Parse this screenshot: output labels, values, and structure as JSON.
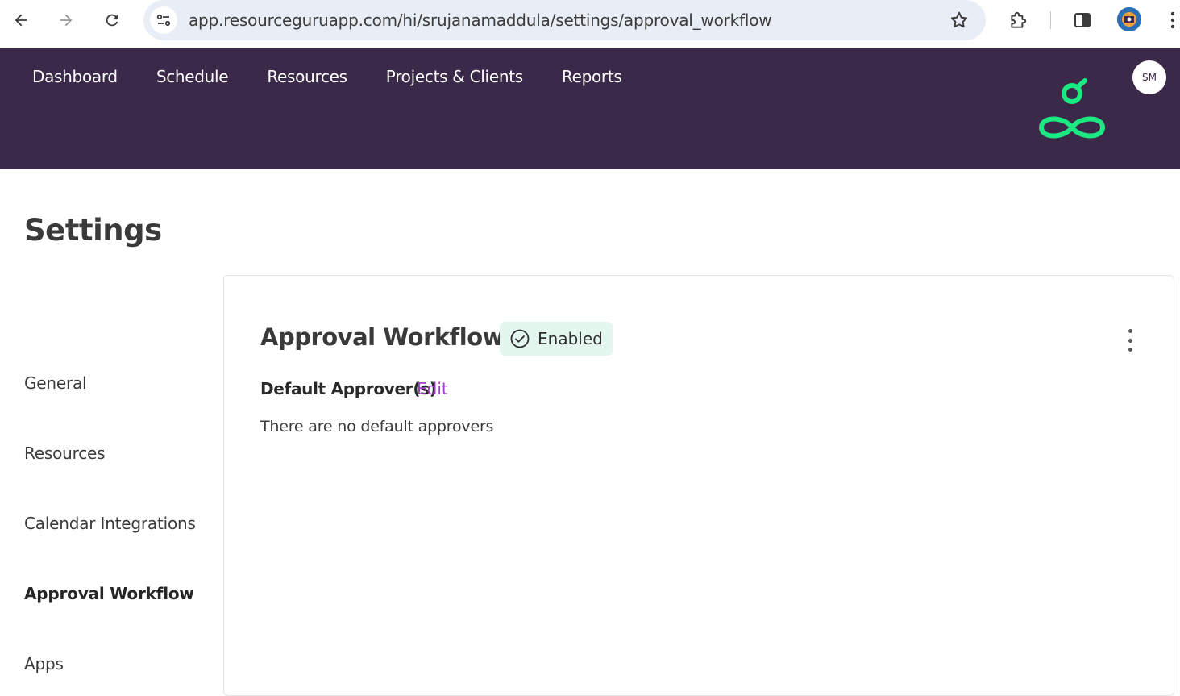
{
  "browser": {
    "url": "app.resourceguruapp.com/hi/srujanamaddula/settings/approval_workflow"
  },
  "header": {
    "nav": [
      "Dashboard",
      "Schedule",
      "Resources",
      "Projects & Clients",
      "Reports"
    ],
    "avatar_initials": "SM",
    "brand_color": "#1de982",
    "background": "#3a2949"
  },
  "page": {
    "title": "Settings"
  },
  "sidebar": {
    "items": [
      {
        "label": "General",
        "active": false
      },
      {
        "label": "Resources",
        "active": false
      },
      {
        "label": "Calendar Integrations",
        "active": false
      },
      {
        "label": "Approval Workflow",
        "active": true
      },
      {
        "label": "Apps",
        "active": false
      }
    ]
  },
  "card": {
    "title": "Approval Workflow",
    "status_badge": "Enabled",
    "default_approvers_label": "Default Approver(s)",
    "edit_label": "Edit",
    "empty_message": "There are no default approvers"
  }
}
